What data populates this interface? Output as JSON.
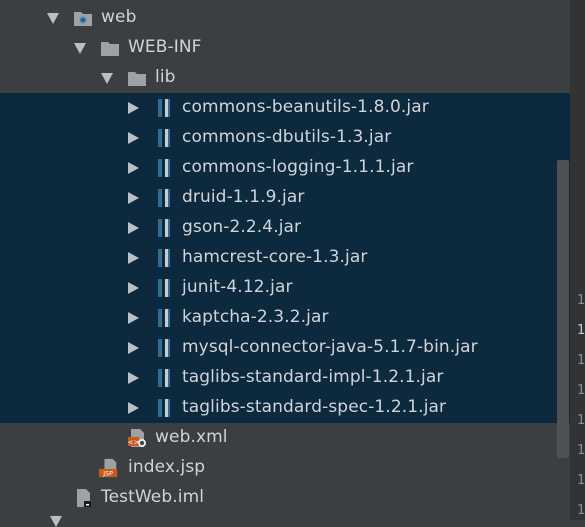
{
  "tree": {
    "web": "web",
    "web_inf": "WEB-INF",
    "lib": "lib",
    "jars": [
      "commons-beanutils-1.8.0.jar",
      "commons-dbutils-1.3.jar",
      "commons-logging-1.1.1.jar",
      "druid-1.1.9.jar",
      "gson-2.2.4.jar",
      "hamcrest-core-1.3.jar",
      "junit-4.12.jar",
      "kaptcha-2.3.2.jar",
      "mysql-connector-java-5.1.7-bin.jar",
      "taglibs-standard-impl-1.2.1.jar",
      "taglibs-standard-spec-1.2.1.jar"
    ],
    "web_xml": "web.xml",
    "index_jsp": "index.jsp",
    "iml": "TestWeb.iml",
    "jsp_badge": "JSP"
  },
  "gutter": [
    "1",
    "1",
    "1",
    "1",
    "1",
    "1",
    "1",
    "1"
  ],
  "colors": {
    "background": "#3c3f41",
    "selection": "#0d293e",
    "text": "#d0d4d8",
    "folder": "#9da2a6",
    "jar_bar": "#2f6f95",
    "jsp_orange": "#c85a1e"
  }
}
